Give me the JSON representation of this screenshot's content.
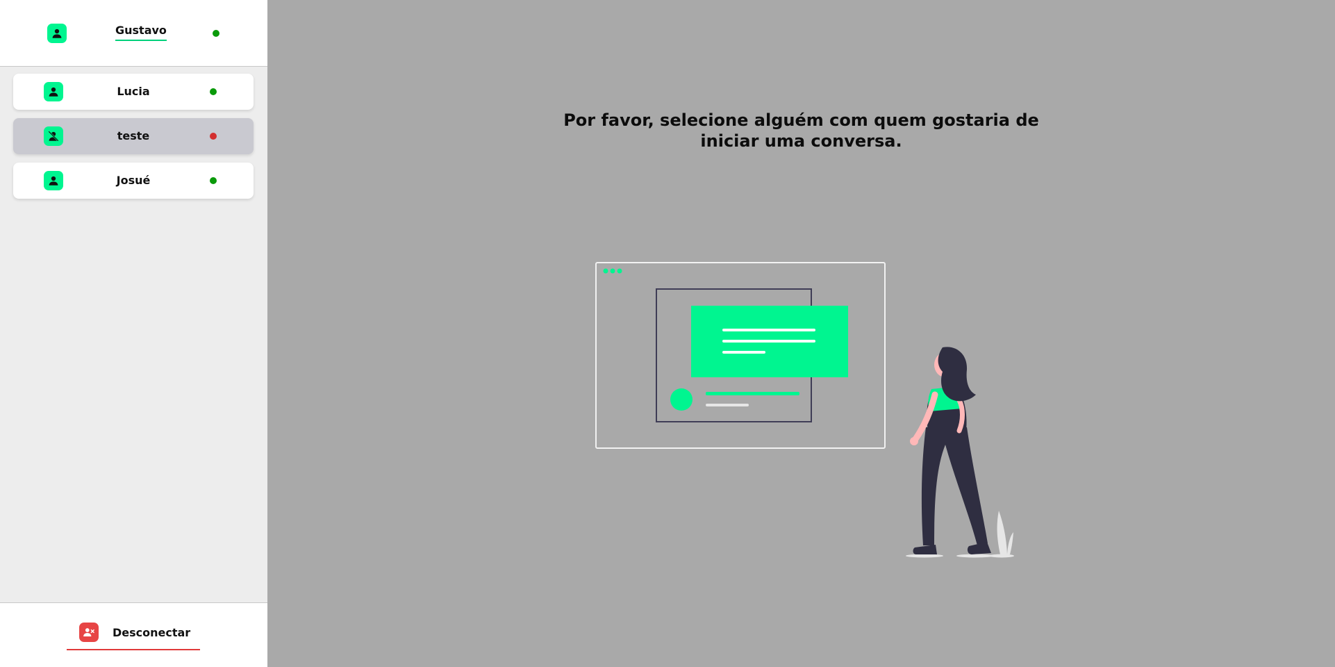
{
  "colors": {
    "accent": "#00f590",
    "online": "#0a9a0a",
    "offline": "#d32f2f",
    "disconnect": "#e74545"
  },
  "current_user": {
    "name": "Gustavo",
    "status": "online",
    "icon": "user-icon"
  },
  "contacts": [
    {
      "name": "Lucia",
      "status": "online",
      "icon": "user-icon",
      "selected": false
    },
    {
      "name": "teste",
      "status": "offline",
      "icon": "user-off-icon",
      "selected": true
    },
    {
      "name": "Josué",
      "status": "online",
      "icon": "user-icon",
      "selected": false
    }
  ],
  "footer": {
    "disconnect_label": "Desconectar",
    "disconnect_icon": "user-remove-icon"
  },
  "main": {
    "prompt": "Por favor, selecione alguém com quem gostaria de iniciar uma conversa.",
    "illustration": "woman-looking-at-chat-window-illustration"
  }
}
